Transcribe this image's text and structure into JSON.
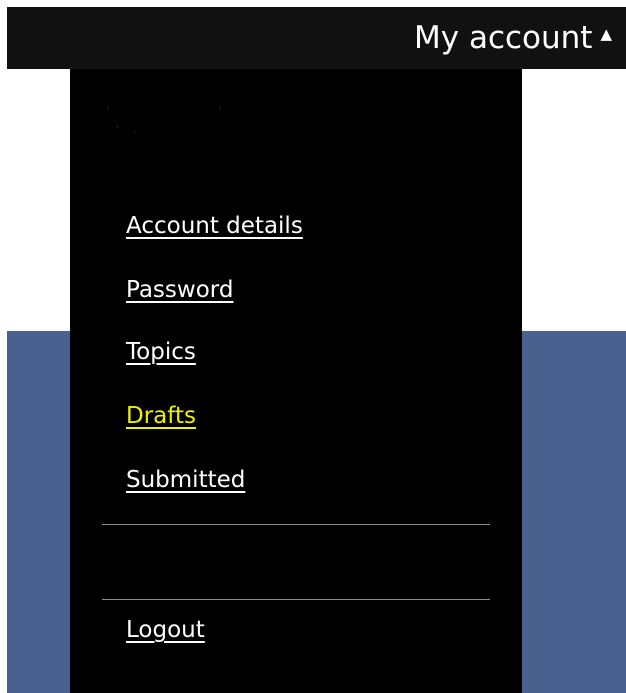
{
  "header": {
    "account_label": "My account",
    "caret_icon": "triangle-up-icon"
  },
  "menu": {
    "items": [
      {
        "label": "Account details",
        "active": false
      },
      {
        "label": "Password",
        "active": false
      },
      {
        "label": "Topics",
        "active": false
      },
      {
        "label": "Drafts",
        "active": true
      },
      {
        "label": "Submitted",
        "active": false
      }
    ],
    "logout_label": "Logout"
  },
  "colors": {
    "header_bg": "#111111",
    "menu_bg": "#000000",
    "band_bg": "#4a6190",
    "active_link": "#f0f000",
    "link": "#ffffff"
  }
}
